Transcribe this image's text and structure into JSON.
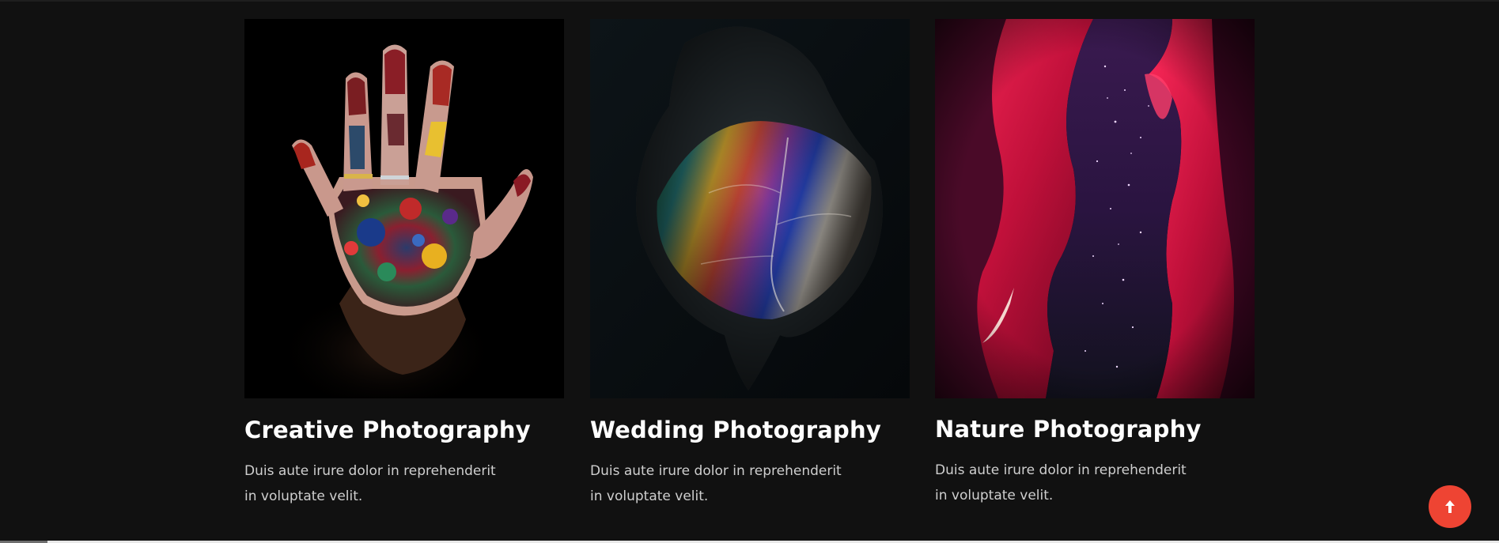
{
  "cards": [
    {
      "title": "Creative Photography",
      "description": "Duis aute irure dolor in reprehenderit in voluptate velit.",
      "image": "painted-hand-photo"
    },
    {
      "title": "Wedding Photography",
      "description": "Duis aute irure dolor in reprehenderit in voluptate velit.",
      "image": "rainbow-leaf-photo"
    },
    {
      "title": "Nature Photography",
      "description": "Duis aute irure dolor in reprehenderit in voluptate velit.",
      "image": "red-canyon-starry-sky-photo"
    }
  ],
  "scroll_top": {
    "icon": "arrow-up-icon",
    "color": "#ee4433"
  },
  "colors": {
    "background": "#111111",
    "title": "#ffffff",
    "description": "#cfcfcf"
  }
}
